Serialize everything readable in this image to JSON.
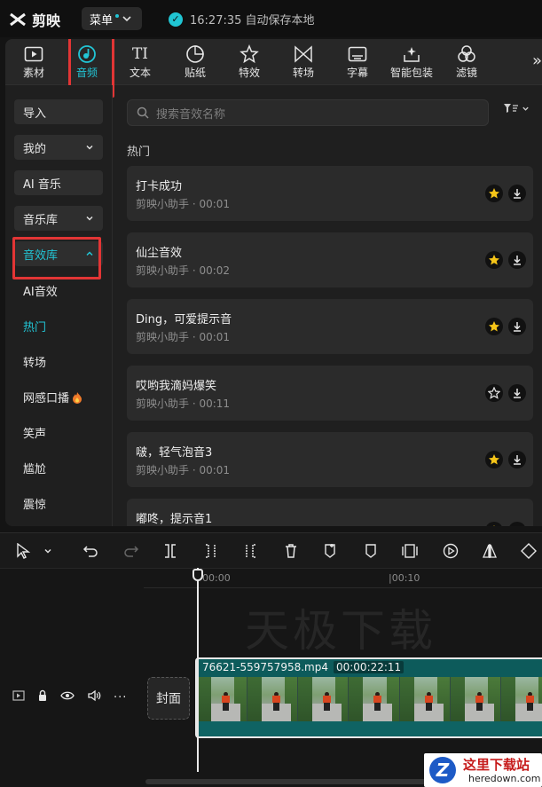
{
  "app": {
    "name": "剪映"
  },
  "titlebar": {
    "menu_label": "菜单",
    "save_status": "16:27:35 自动保存本地"
  },
  "toolbar": {
    "tabs": [
      {
        "label": "素材",
        "icon": "media-icon"
      },
      {
        "label": "音频",
        "icon": "audio-icon",
        "active": true
      },
      {
        "label": "文本",
        "icon": "text-icon"
      },
      {
        "label": "贴纸",
        "icon": "sticker-icon"
      },
      {
        "label": "特效",
        "icon": "effects-icon"
      },
      {
        "label": "转场",
        "icon": "transition-icon"
      },
      {
        "label": "字幕",
        "icon": "subtitle-icon"
      },
      {
        "label": "智能包装",
        "icon": "smart-pack-icon"
      },
      {
        "label": "滤镜",
        "icon": "filter-icon"
      }
    ],
    "more": "»"
  },
  "sidebar": {
    "import": "导入",
    "mine": "我的",
    "ai_music": "AI 音乐",
    "music_library": "音乐库",
    "sfx_library": "音效库",
    "sub_items": [
      "AI音效",
      "热门",
      "转场",
      "网感口播",
      "笑声",
      "尴尬",
      "震惊"
    ],
    "active_sub": "热门"
  },
  "search": {
    "placeholder": "搜索音效名称"
  },
  "section": {
    "label": "热门"
  },
  "sounds": [
    {
      "title": "打卡成功",
      "meta": "剪映小助手 · 00:01",
      "favorited": true
    },
    {
      "title": "仙尘音效",
      "meta": "剪映小助手 · 00:02",
      "favorited": true
    },
    {
      "title": "Ding，可爱提示音",
      "meta": "剪映小助手 · 00:01",
      "favorited": true
    },
    {
      "title": "哎哟我滴妈爆笑",
      "meta": "剪映小助手 · 00:11",
      "favorited": false
    },
    {
      "title": "啵，轻气泡音3",
      "meta": "剪映小助手 · 00:01",
      "favorited": true
    },
    {
      "title": "嘟咚，提示音1",
      "meta": "",
      "favorited": true
    }
  ],
  "timeline": {
    "ruler": [
      "00:00",
      "|00:10"
    ],
    "watermark": "天极下载",
    "cover_label": "封面",
    "clip_name": "76621-559757958.mp4",
    "clip_duration": "00:00:22:11"
  },
  "site_badge": {
    "title": "这里下载站",
    "url": "heredown.com"
  },
  "colors": {
    "accent": "#22c5d5",
    "highlight_box": "#e23535",
    "star": "#f5c518"
  }
}
